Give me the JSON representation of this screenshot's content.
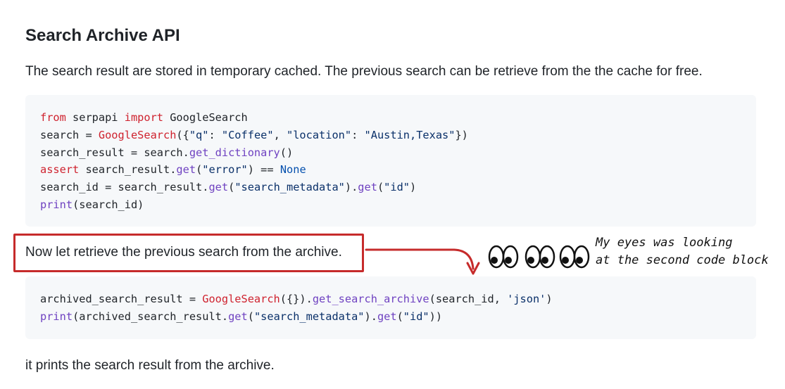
{
  "heading": "Search Archive API",
  "intro": "The search result are stored in temporary cached. The previous search can be retrieve from the the cache for free.",
  "code1": [
    [
      {
        "t": "from",
        "c": "kw"
      },
      {
        "t": " serpapi ",
        "c": "pl"
      },
      {
        "t": "import",
        "c": "kw"
      },
      {
        "t": " GoogleSearch",
        "c": "pl"
      }
    ],
    [
      {
        "t": "search = ",
        "c": "pl"
      },
      {
        "t": "GoogleSearch",
        "c": "kw"
      },
      {
        "t": "({",
        "c": "pl"
      },
      {
        "t": "\"q\"",
        "c": "st"
      },
      {
        "t": ": ",
        "c": "pl"
      },
      {
        "t": "\"Coffee\"",
        "c": "st"
      },
      {
        "t": ", ",
        "c": "pl"
      },
      {
        "t": "\"location\"",
        "c": "st"
      },
      {
        "t": ": ",
        "c": "pl"
      },
      {
        "t": "\"Austin,Texas\"",
        "c": "st"
      },
      {
        "t": "})",
        "c": "pl"
      }
    ],
    [
      {
        "t": "search_result = search.",
        "c": "pl"
      },
      {
        "t": "get_dictionary",
        "c": "fn"
      },
      {
        "t": "()",
        "c": "pl"
      }
    ],
    [
      {
        "t": "assert",
        "c": "kw"
      },
      {
        "t": " search_result.",
        "c": "pl"
      },
      {
        "t": "get",
        "c": "fn"
      },
      {
        "t": "(",
        "c": "pl"
      },
      {
        "t": "\"error\"",
        "c": "st"
      },
      {
        "t": ") == ",
        "c": "pl"
      },
      {
        "t": "None",
        "c": "cn"
      }
    ],
    [
      {
        "t": "search_id = search_result.",
        "c": "pl"
      },
      {
        "t": "get",
        "c": "fn"
      },
      {
        "t": "(",
        "c": "pl"
      },
      {
        "t": "\"search_metadata\"",
        "c": "st"
      },
      {
        "t": ").",
        "c": "pl"
      },
      {
        "t": "get",
        "c": "fn"
      },
      {
        "t": "(",
        "c": "pl"
      },
      {
        "t": "\"id\"",
        "c": "st"
      },
      {
        "t": ")",
        "c": "pl"
      }
    ],
    [
      {
        "t": "print",
        "c": "fn"
      },
      {
        "t": "(search_id)",
        "c": "pl"
      }
    ]
  ],
  "retrieve_text": "Now let retrieve the previous search from the archive.",
  "code2": [
    [
      {
        "t": "archived_search_result = ",
        "c": "pl"
      },
      {
        "t": "GoogleSearch",
        "c": "kw"
      },
      {
        "t": "({}).",
        "c": "pl"
      },
      {
        "t": "get_search_archive",
        "c": "fn"
      },
      {
        "t": "(search_id, ",
        "c": "pl"
      },
      {
        "t": "'json'",
        "c": "st"
      },
      {
        "t": ")",
        "c": "pl"
      }
    ],
    [
      {
        "t": "print",
        "c": "fn"
      },
      {
        "t": "(archived_search_result.",
        "c": "pl"
      },
      {
        "t": "get",
        "c": "fn"
      },
      {
        "t": "(",
        "c": "pl"
      },
      {
        "t": "\"search_metadata\"",
        "c": "st"
      },
      {
        "t": ").",
        "c": "pl"
      },
      {
        "t": "get",
        "c": "fn"
      },
      {
        "t": "(",
        "c": "pl"
      },
      {
        "t": "\"id\"",
        "c": "st"
      },
      {
        "t": "))",
        "c": "pl"
      }
    ]
  ],
  "outro": "it prints the search result from the archive.",
  "annotation": {
    "line1": "My eyes was looking",
    "line2": "at the second code block",
    "box_color": "#c62b2b"
  }
}
